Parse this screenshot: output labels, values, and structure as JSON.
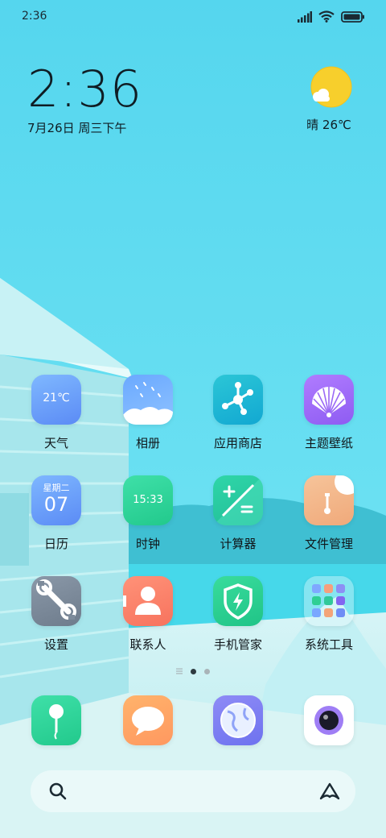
{
  "status_bar": {
    "time": "2:36",
    "icons": [
      "signal-icon",
      "wifi-icon",
      "battery-icon"
    ]
  },
  "clock": {
    "time": "2:36",
    "date": "7月26日 周三下午"
  },
  "weather": {
    "condition": "晴",
    "temp": "26℃",
    "text": "晴 26℃",
    "icon": "sun-cloud-icon"
  },
  "apps": [
    {
      "label": "天气",
      "icon": "weather-app-icon",
      "badge": "21℃"
    },
    {
      "label": "相册",
      "icon": "gallery-icon"
    },
    {
      "label": "应用商店",
      "icon": "app-store-icon"
    },
    {
      "label": "主题壁纸",
      "icon": "themes-icon"
    },
    {
      "label": "日历",
      "icon": "calendar-icon",
      "weekday": "星期二",
      "day": "07"
    },
    {
      "label": "时钟",
      "icon": "clock-app-icon",
      "time": "15:33"
    },
    {
      "label": "计算器",
      "icon": "calculator-icon"
    },
    {
      "label": "文件管理",
      "icon": "file-manager-icon"
    },
    {
      "label": "设置",
      "icon": "settings-icon"
    },
    {
      "label": "联系人",
      "icon": "contacts-icon"
    },
    {
      "label": "手机管家",
      "icon": "phone-manager-icon"
    },
    {
      "label": "系统工具",
      "icon": "system-tools-folder-icon"
    }
  ],
  "dock": [
    {
      "icon": "phone-icon"
    },
    {
      "icon": "messages-icon"
    },
    {
      "icon": "browser-icon"
    },
    {
      "icon": "camera-icon"
    }
  ],
  "page_indicator": {
    "pages": 2,
    "active": 1
  },
  "colors": {
    "sky": "#5fdcf0",
    "text": "#10161a"
  }
}
